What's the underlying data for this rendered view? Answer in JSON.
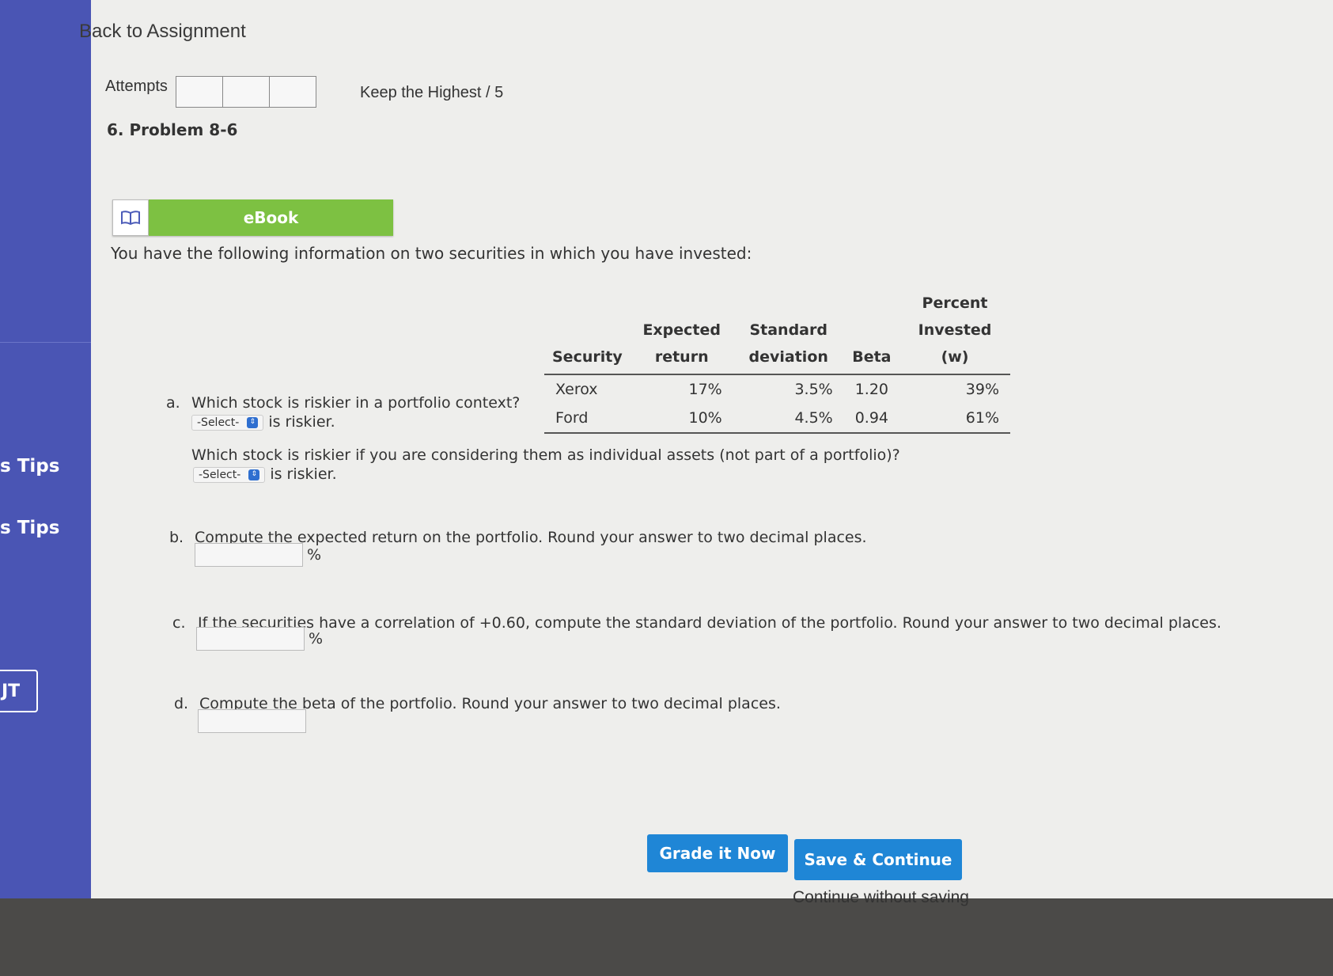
{
  "nav": {
    "back_label": "Back to Assignment",
    "side_tip_1": "s Tips",
    "side_tip_2": "s Tips",
    "side_ut": "JT"
  },
  "attempts": {
    "label": "Attempts",
    "keep_label": "Keep the Highest / 5"
  },
  "problem": {
    "title": "6.  Problem 8-6",
    "ebook_label": "eBook",
    "intro": "You have the following information on two securities in which you have invested:"
  },
  "table": {
    "headers": [
      "Security",
      "Expected return",
      "Standard deviation",
      "Beta",
      "Percent Invested (w)"
    ],
    "rows": [
      [
        "Xerox",
        "17%",
        "3.5%",
        "1.20",
        "39%"
      ],
      [
        "Ford",
        "10%",
        "4.5%",
        "0.94",
        "61%"
      ]
    ]
  },
  "questions": {
    "a": {
      "letter": "a.",
      "text1": "Which stock is riskier in a portfolio context?",
      "select1": "-Select-",
      "suffix1": "is riskier.",
      "text2": "Which stock is riskier if you are considering them as individual assets (not part of a portfolio)?",
      "select2": "-Select-",
      "suffix2": "is riskier."
    },
    "b": {
      "letter": "b.",
      "text": "Compute the expected return on the portfolio. Round your answer to two decimal places.",
      "unit": "%"
    },
    "c": {
      "letter": "c.",
      "text": "If the securities have a correlation of +0.60, compute the standard deviation of the portfolio. Round your answer to two decimal places.",
      "unit": "%"
    },
    "d": {
      "letter": "d.",
      "text": "Compute the beta of the portfolio. Round your answer to two decimal places."
    }
  },
  "actions": {
    "grade_label": "Grade it Now",
    "save_label": "Save & Continue",
    "continue_label": "Continue without saving"
  }
}
